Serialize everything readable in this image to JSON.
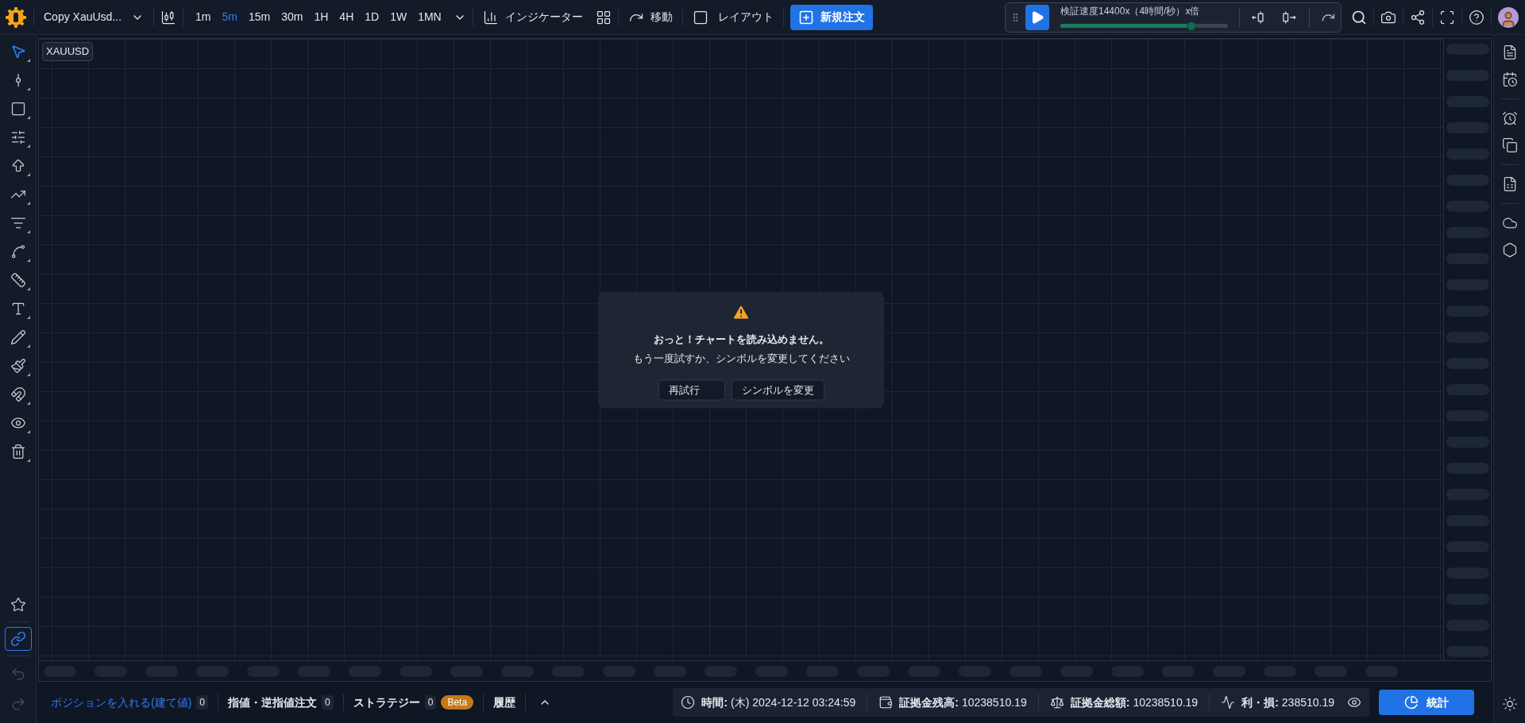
{
  "top_bar": {
    "symbol": "Copy XauUsd...",
    "timeframes": [
      {
        "label": "1m",
        "selected": false
      },
      {
        "label": "5m",
        "selected": true
      },
      {
        "label": "15m",
        "selected": false
      },
      {
        "label": "30m",
        "selected": false
      },
      {
        "label": "1H",
        "selected": false
      },
      {
        "label": "4H",
        "selected": false
      },
      {
        "label": "1D",
        "selected": false
      },
      {
        "label": "1W",
        "selected": false
      },
      {
        "label": "1MN",
        "selected": false
      }
    ],
    "indicators": "インジケーター",
    "move": "移動",
    "layout": "レイアウト",
    "new_order": "新規注文",
    "replay": {
      "speed_label": "検証速度14400x（4時間/秒）x倍",
      "level": 0.78
    }
  },
  "left_tools": [
    {
      "kind": "cursor",
      "selected": true
    },
    {
      "kind": "line",
      "selected": false
    },
    {
      "kind": "rect",
      "selected": false
    },
    {
      "kind": "fib",
      "selected": false
    },
    {
      "kind": "arrow",
      "selected": false
    },
    {
      "kind": "trend",
      "selected": false
    },
    {
      "kind": "channel",
      "selected": false
    },
    {
      "kind": "pattern",
      "selected": false
    },
    {
      "kind": "ruler",
      "selected": false
    },
    {
      "kind": "text",
      "selected": false
    },
    {
      "kind": "pen",
      "selected": false
    },
    {
      "kind": "brush",
      "selected": false
    },
    {
      "kind": "magnet",
      "selected": false
    },
    {
      "kind": "eye",
      "selected": false
    },
    {
      "kind": "trash",
      "selected": false
    }
  ],
  "left_bottom_tools": [
    {
      "kind": "star",
      "selected": false
    },
    {
      "kind": "link",
      "selected": true
    }
  ],
  "chart": {
    "symbol": "XAUUSD",
    "error": {
      "title": "おっと！チャートを読み込めません。",
      "message": "もう一度試すか、シンボルを変更してください",
      "buttons": [
        "再試行",
        "シンボルを変更"
      ]
    }
  },
  "bottom_bar": {
    "tabs": [
      {
        "label": "ポジションを入れる(建て値)",
        "count": "0",
        "selected": true
      },
      {
        "label": "指値・逆指値注文",
        "count": "0",
        "selected": false
      },
      {
        "label": "ストラテジー",
        "count": "0",
        "badge": "Beta",
        "selected": false
      },
      {
        "label": "履歴",
        "selected": false
      }
    ],
    "status": [
      {
        "kind": "time",
        "label": "時間:",
        "value": "(木) 2024-12-12 03:24:59"
      },
      {
        "kind": "balance",
        "label": "証拠金残高:",
        "value": "10238510.19"
      },
      {
        "kind": "equity",
        "label": "証拠金総額:",
        "value": "10238510.19"
      },
      {
        "kind": "pnl",
        "label": "利・損:",
        "value": "238510.19"
      }
    ],
    "stats_button": "統計"
  }
}
